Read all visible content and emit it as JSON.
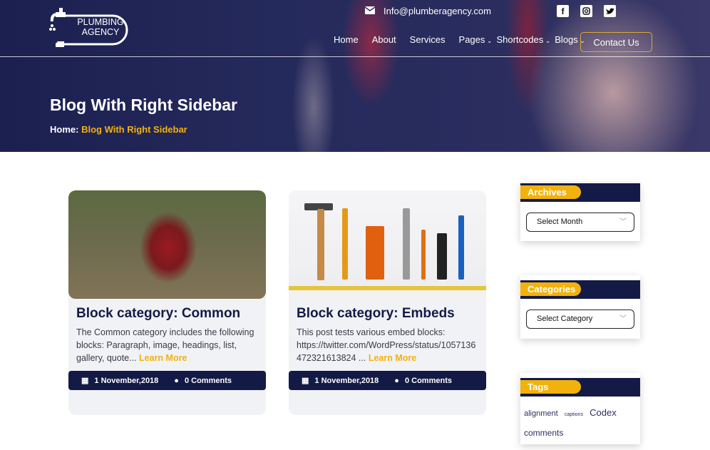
{
  "header": {
    "logo_text": [
      "PLUMBING",
      "AGENCY"
    ],
    "email": "Info@plumberagency.com",
    "social": [
      "facebook-icon",
      "instagram-icon",
      "twitter-icon"
    ],
    "nav": [
      {
        "label": "Home"
      },
      {
        "label": "About"
      },
      {
        "label": "Services"
      },
      {
        "label": "Pages",
        "dropdown": true
      },
      {
        "label": "Shortcodes",
        "dropdown": true
      },
      {
        "label": "Blogs",
        "dropdown": true
      }
    ],
    "contact_label": "Contact Us"
  },
  "hero": {
    "title": "Blog With Right Sidebar",
    "breadcrumb_home": "Home",
    "breadcrumb_sep": ":",
    "breadcrumb_current": "Blog With Right Sidebar"
  },
  "posts": [
    {
      "title": "Block category: Common",
      "excerpt": "The Common category includes the following blocks: Paragraph, image, headings, list, gallery, quote...",
      "more": "Learn More",
      "date": "1 November,2018",
      "comments": "0 Comments"
    },
    {
      "title": "Block category: Embeds",
      "excerpt": "This post tests various embed blocks: https://twitter.com/WordPress/status/1057136 472321613824 ...",
      "more": "Learn More",
      "date": "1 November,2018",
      "comments": "0 Comments"
    }
  ],
  "sidebar": {
    "archives": {
      "title": "Archives",
      "select": "Select Month"
    },
    "categories": {
      "title": "Categories",
      "select": "Select Category"
    },
    "tags": {
      "title": "Tags",
      "items": [
        "alignment",
        "captions",
        "Codex",
        "comments"
      ]
    }
  },
  "colors": {
    "navy": "#141a46",
    "accent": "#f2b20d"
  }
}
